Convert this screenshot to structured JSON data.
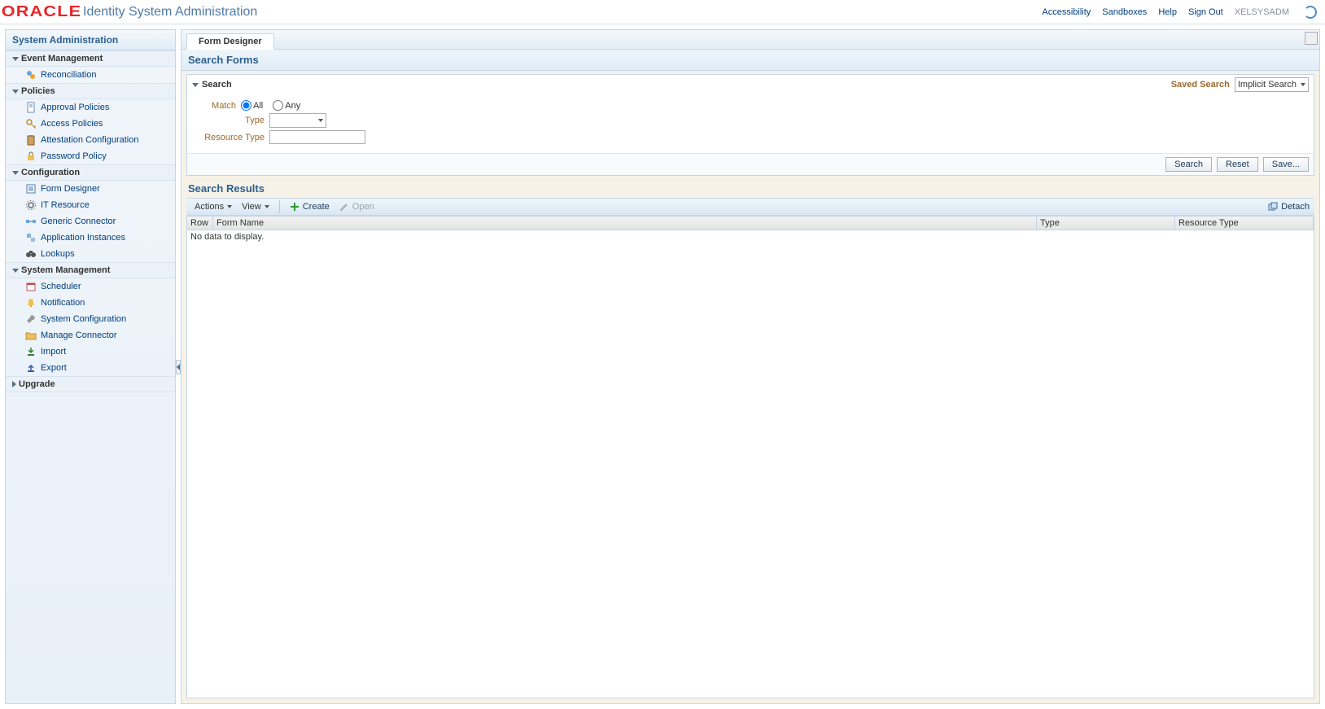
{
  "header": {
    "brand": "ORACLE",
    "app_title": "Identity System Administration",
    "links": {
      "accessibility": "Accessibility",
      "sandboxes": "Sandboxes",
      "help": "Help",
      "signout": "Sign Out"
    },
    "user": "XELSYSADM"
  },
  "sidebar": {
    "title": "System Administration",
    "sections": [
      {
        "label": "Event Management",
        "open": true,
        "items": [
          {
            "label": "Reconciliation",
            "icon": "recon-icon"
          }
        ]
      },
      {
        "label": "Policies",
        "open": true,
        "items": [
          {
            "label": "Approval Policies",
            "icon": "doc-icon"
          },
          {
            "label": "Access Policies",
            "icon": "key-icon"
          },
          {
            "label": "Attestation Configuration",
            "icon": "clipboard-icon"
          },
          {
            "label": "Password Policy",
            "icon": "lock-icon"
          }
        ]
      },
      {
        "label": "Configuration",
        "open": true,
        "items": [
          {
            "label": "Form Designer",
            "icon": "form-icon"
          },
          {
            "label": "IT Resource",
            "icon": "gear-icon"
          },
          {
            "label": "Generic Connector",
            "icon": "connector-icon"
          },
          {
            "label": "Application Instances",
            "icon": "app-icon"
          },
          {
            "label": "Lookups",
            "icon": "binoculars-icon"
          }
        ]
      },
      {
        "label": "System Management",
        "open": true,
        "items": [
          {
            "label": "Scheduler",
            "icon": "calendar-icon"
          },
          {
            "label": "Notification",
            "icon": "bell-icon"
          },
          {
            "label": "System Configuration",
            "icon": "wrench-icon"
          },
          {
            "label": "Manage Connector",
            "icon": "folder-icon"
          },
          {
            "label": "Import",
            "icon": "import-icon"
          },
          {
            "label": "Export",
            "icon": "export-icon"
          }
        ]
      },
      {
        "label": "Upgrade",
        "open": false,
        "items": []
      }
    ]
  },
  "tab": {
    "label": "Form Designer"
  },
  "page": {
    "title": "Search Forms"
  },
  "search": {
    "heading": "Search",
    "saved_label": "Saved Search",
    "saved_value": "Implicit Search",
    "match_label": "Match",
    "match_all": "All",
    "match_any": "Any",
    "match_selected": "all",
    "type_label": "Type",
    "type_value": "",
    "restype_label": "Resource Type",
    "restype_value": "",
    "buttons": {
      "search": "Search",
      "reset": "Reset",
      "save": "Save..."
    }
  },
  "results": {
    "title": "Search Results",
    "toolbar": {
      "actions": "Actions",
      "view": "View",
      "create": "Create",
      "open": "Open",
      "detach": "Detach"
    },
    "columns": {
      "row": "Row",
      "name": "Form Name",
      "type": "Type",
      "res": "Resource Type"
    },
    "empty": "No data to display."
  }
}
